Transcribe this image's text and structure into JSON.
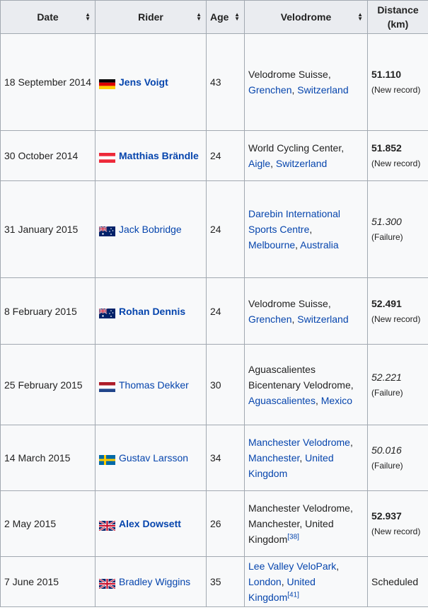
{
  "headers": {
    "date": "Date",
    "rider": "Rider",
    "age": "Age",
    "velodrome": "Velodrome",
    "distance_line1": "Distance",
    "distance_line2": "(km)"
  },
  "sort_icon": "sort-icon",
  "rows": [
    {
      "date": "18 September 2014",
      "flag": "germany",
      "rider": "Jens Voigt",
      "rider_bold": true,
      "age": "43",
      "velodrome": [
        {
          "t": "Velodrome Suisse,",
          "link": false
        },
        {
          "t": "Grenchen",
          "link": true
        },
        {
          "t": ", ",
          "link": false
        },
        {
          "t": "Switzerland",
          "link": true
        }
      ],
      "distance": "51.110",
      "dist_style": "bold",
      "note": "(New record)"
    },
    {
      "date": "30 October 2014",
      "flag": "austria",
      "rider": "Matthias Brändle",
      "rider_bold": true,
      "age": "24",
      "velodrome": [
        {
          "t": "World Cycling Center,",
          "link": false
        },
        {
          "t": "Aigle",
          "link": true
        },
        {
          "t": ", ",
          "link": false
        },
        {
          "t": "Switzerland",
          "link": true
        }
      ],
      "distance": "51.852",
      "dist_style": "bold",
      "note": "(New record)"
    },
    {
      "date": "31 January 2015",
      "flag": "australia",
      "rider": "Jack Bobridge",
      "rider_bold": false,
      "age": "24",
      "velodrome": [
        {
          "t": "Darebin International Sports Centre",
          "link": true
        },
        {
          "t": ", ",
          "link": false
        },
        {
          "t": "Melbourne",
          "link": true
        },
        {
          "t": ", ",
          "link": false
        },
        {
          "t": "Australia",
          "link": true
        }
      ],
      "distance": "51.300",
      "dist_style": "italic",
      "note": "(Failure)"
    },
    {
      "date": "8 February 2015",
      "flag": "australia",
      "rider": "Rohan Dennis",
      "rider_bold": true,
      "age": "24",
      "velodrome": [
        {
          "t": "Velodrome Suisse,",
          "link": false
        },
        {
          "t": "Grenchen",
          "link": true
        },
        {
          "t": ", ",
          "link": false
        },
        {
          "t": "Switzerland",
          "link": true
        }
      ],
      "distance": "52.491",
      "dist_style": "bold",
      "note": "(New record)"
    },
    {
      "date": "25 February 2015",
      "flag": "netherlands",
      "rider": "Thomas Dekker",
      "rider_bold": false,
      "age": "30",
      "velodrome": [
        {
          "t": "Aguascalientes Bicentenary Velodrome,",
          "link": false
        },
        {
          "t": "Aguascalientes",
          "link": true
        },
        {
          "t": ", ",
          "link": false
        },
        {
          "t": "Mexico",
          "link": true
        }
      ],
      "distance": "52.221",
      "dist_style": "italic",
      "note": "(Failure)"
    },
    {
      "date": "14 March 2015",
      "flag": "sweden",
      "rider": "Gustav Larsson",
      "rider_bold": false,
      "age": "34",
      "velodrome": [
        {
          "t": "Manchester Velodrome",
          "link": true
        },
        {
          "t": ", ",
          "link": false
        },
        {
          "t": "Manchester",
          "link": true
        },
        {
          "t": ", ",
          "link": false
        },
        {
          "t": "United Kingdom",
          "link": true
        }
      ],
      "distance": "50.016",
      "dist_style": "italic",
      "note": "(Failure)"
    },
    {
      "date": "2 May 2015",
      "flag": "uk",
      "rider": "Alex Dowsett",
      "rider_bold": true,
      "age": "26",
      "velodrome": [
        {
          "t": "Manchester Velodrome, Manchester, United Kingdom",
          "link": false
        },
        {
          "t": "[38]",
          "link": true,
          "sup": true
        }
      ],
      "distance": "52.937",
      "dist_style": "bold",
      "note": "(New record)"
    },
    {
      "date": "7 June 2015",
      "flag": "uk",
      "rider": "Bradley Wiggins",
      "rider_bold": false,
      "age": "35",
      "velodrome": [
        {
          "t": "Lee Valley VeloPark",
          "link": true
        },
        {
          "t": ", ",
          "link": false
        },
        {
          "t": "London",
          "link": true
        },
        {
          "t": ", ",
          "link": false
        },
        {
          "t": "United Kingdom",
          "link": true
        },
        {
          "t": "[41]",
          "link": true,
          "sup": true
        }
      ],
      "distance": "Scheduled",
      "dist_style": "plain",
      "note": ""
    }
  ]
}
